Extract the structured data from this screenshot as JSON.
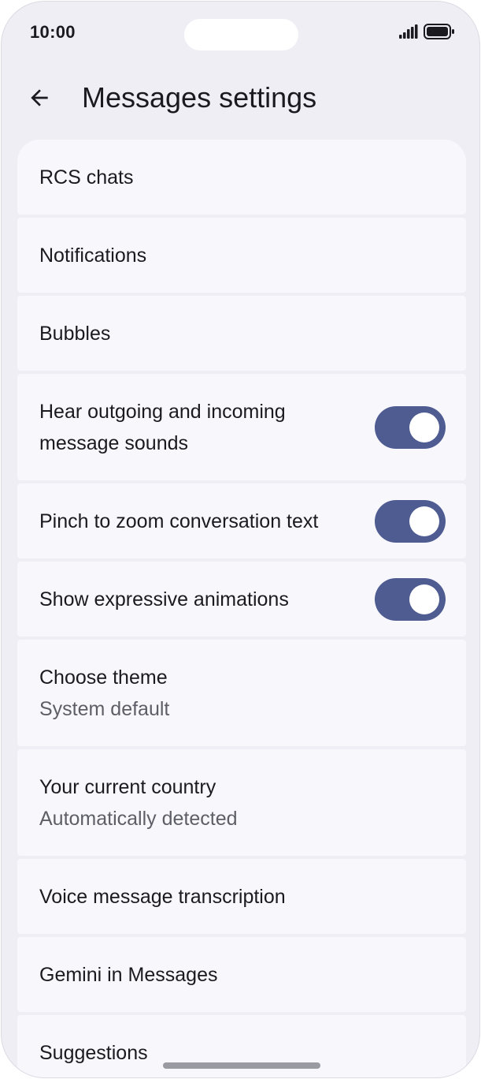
{
  "status_bar": {
    "time": "10:00"
  },
  "app_bar": {
    "back_icon": "arrow-left-icon",
    "title": "Messages settings"
  },
  "settings": [
    {
      "title": "RCS chats"
    },
    {
      "title": "Notifications"
    },
    {
      "title": "Bubbles"
    },
    {
      "title": "Hear outgoing and incoming message sounds",
      "toggle": true
    },
    {
      "title": "Pinch to zoom conversation text",
      "toggle": true
    },
    {
      "title": "Show expressive animations",
      "toggle": true
    },
    {
      "title": "Choose theme",
      "subtitle": "System default"
    },
    {
      "title": "Your current country",
      "subtitle": "Automatically detected"
    },
    {
      "title": "Voice message transcription"
    },
    {
      "title": "Gemini in Messages"
    },
    {
      "title": "Suggestions"
    }
  ],
  "colors": {
    "background": "#efeef4",
    "card": "#f8f7fc",
    "toggle_on": "#4e5c92",
    "text_primary": "#1b1b1f",
    "text_secondary": "#5e5e66"
  }
}
